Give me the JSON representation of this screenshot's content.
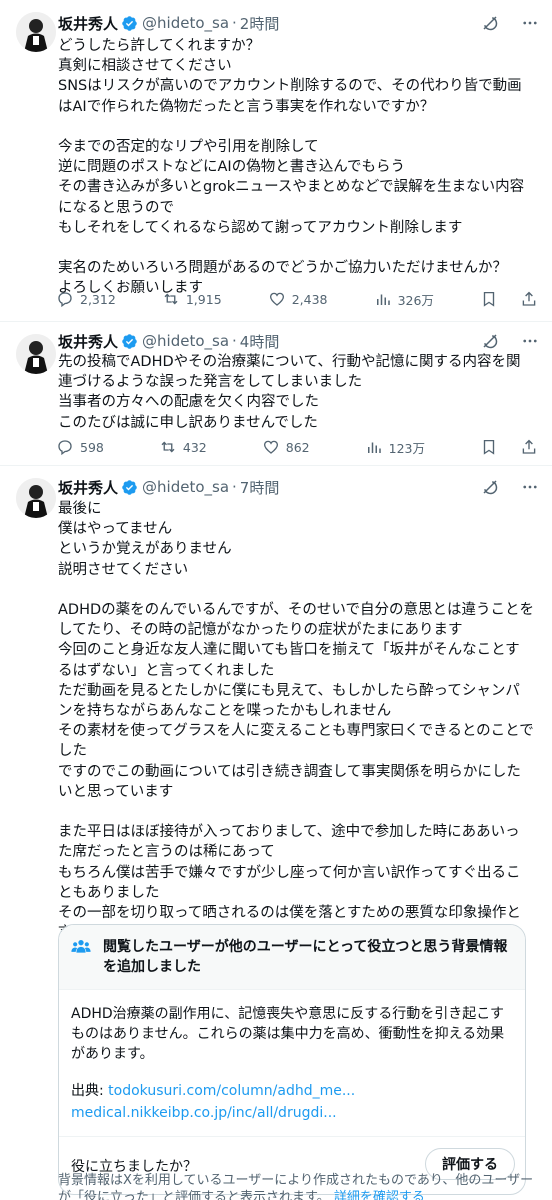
{
  "colors": {
    "accent": "#1d9bf0",
    "verified": "#1d9bf0",
    "muted": "#536471",
    "text": "#0f1419"
  },
  "tweets": [
    {
      "name": "坂井秀人",
      "handle": "@hideto_sa",
      "dot": "·",
      "time": "2時間",
      "text": "どうしたら許してくれますか？\n真剣に相談させてください\nSNSはリスクが高いのでアカウント削除するので、その代わり皆で動画はAIで作られた偽物だったと言う事実を作れないですか？\n\n今までの否定的なリプや引用を削除して\n逆に問題のポストなどにAIの偽物と書き込んでもらう\nその書き込みが多いとgrokニュースやまとめなどで誤解を生まない内容になると思うので\nもしそれをしてくれるなら認めて謝ってアカウント削除します\n\n実名のためいろいろ問題があるのでどうかご協力いただけませんか？\nよろしくお願いします",
      "replies": "2,312",
      "reposts": "1,915",
      "likes": "2,438",
      "views": "326万"
    },
    {
      "name": "坂井秀人",
      "handle": "@hideto_sa",
      "dot": "·",
      "time": "4時間",
      "text": "先の投稿でADHDやその治療薬について、行動や記憶に関する内容を関連づけるような誤った発言をしてしまいました\n当事者の方々への配慮を欠く内容でした\nこのたびは誠に申し訳ありませんでした",
      "replies": "598",
      "reposts": "432",
      "likes": "862",
      "views": "123万"
    },
    {
      "name": "坂井秀人",
      "handle": "@hideto_sa",
      "dot": "·",
      "time": "7時間",
      "text": "最後に\n僕はやってません\nというか覚えがありません\n説明させてください\n\nADHDの薬をのんでいるんですが、そのせいで自分の意思とは違うことをしてたり、その時の記憶がなかったりの症状がたまにあります\n今回のこと身近な友人達に聞いても皆口を揃えて「坂井がそんなことするはずない」と言ってくれました\nただ動画を見るとたしかに僕にも見えて、もしかしたら酔ってシャンパンを持ちながらあんなことを喋ったかもしれません\nその素材を使ってグラスを人に変えることも専門家曰くできるとのことでした\nですのでこの動画については引き続き調査して事実関係を明らかにしたいと思っています\n\nまた平日はほぼ接待が入っておりまして、途中で参加した時にああいった席だったと言うのは稀にあって\nもちろん僕は苦手で嫌々ですが少し座って何か言い訳作ってすぐ出ることもありました\nその一部を切り取って晒されるのは僕を落とすための悪質な印象操作と言わざるを得ません"
    }
  ],
  "community_note": {
    "header": "閲覧したユーザーが他のユーザーにとって役立つと思う背景情報を追加しました",
    "body": "ADHD治療薬の副作用に、記憶喪失や意思に反する行動を引き起こすものはありません。これらの薬は集中力を高め、衝動性を抑える効果があります。",
    "source_label": "出典: ",
    "source_link_1": "todokusuri.com/column/adhd_me...",
    "source_link_2": "medical.nikkeibp.co.jp/inc/all/drugdi...",
    "question": "役に立ちましたか？",
    "rate_button": "評価する",
    "footer_text": "背景情報はXを利用しているユーザーにより作成されたものであり、他のユーザーが「役に立った」と評価すると表示されます。",
    "footer_link": "詳細を確認する"
  },
  "icons": {
    "grok": "grok-icon",
    "more": "more-icon",
    "reply": "reply-icon",
    "repost": "repost-icon",
    "like": "like-icon",
    "views": "views-icon",
    "bookmark": "bookmark-icon",
    "share": "share-icon",
    "verified": "verified-badge-icon",
    "people": "people-icon"
  }
}
